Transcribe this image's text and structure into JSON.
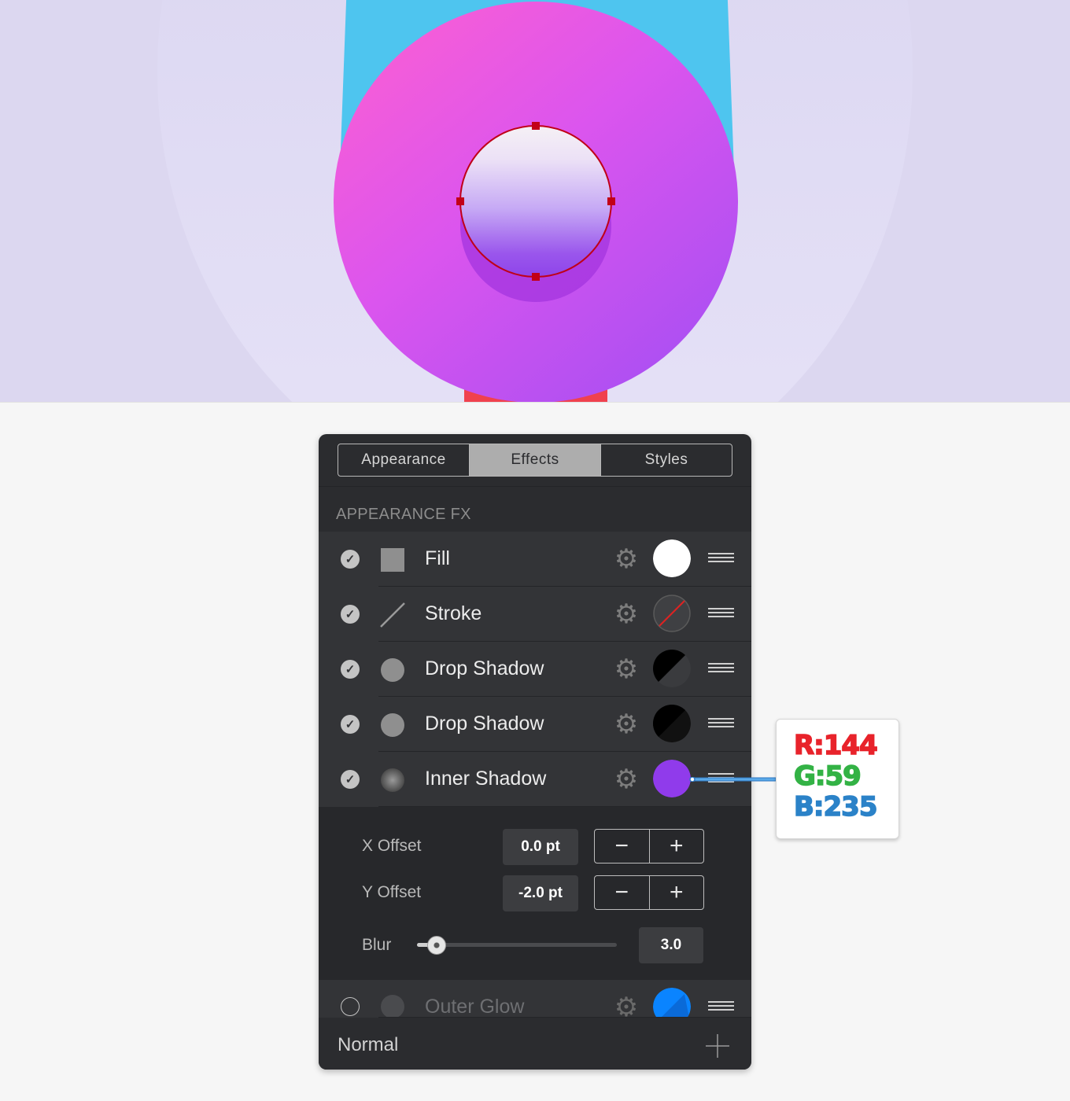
{
  "panel": {
    "tabs": [
      {
        "label": "Appearance",
        "active": false
      },
      {
        "label": "Effects",
        "active": true
      },
      {
        "label": "Styles",
        "active": false
      }
    ],
    "section_title": "APPEARANCE FX",
    "effects": [
      {
        "label": "Fill",
        "enabled": true,
        "icon": "square-fill-icon",
        "swatch": "#ffffff"
      },
      {
        "label": "Stroke",
        "enabled": true,
        "icon": "stroke-line-icon",
        "swatch": "none"
      },
      {
        "label": "Drop Shadow",
        "enabled": true,
        "icon": "circle-icon",
        "swatch": "#000000"
      },
      {
        "label": "Drop Shadow",
        "enabled": true,
        "icon": "circle-icon",
        "swatch": "#000000"
      },
      {
        "label": "Inner Shadow",
        "enabled": true,
        "icon": "soft-circle-icon",
        "swatch": "#903beb"
      },
      {
        "label": "Outer Glow",
        "enabled": false,
        "icon": "circle-icon",
        "swatch": "#0a84ff"
      }
    ],
    "settings": {
      "x_offset_label": "X Offset",
      "x_offset_value": "0.0 pt",
      "y_offset_label": "Y Offset",
      "y_offset_value": "-2.0 pt",
      "blur_label": "Blur",
      "blur_value": "3.0",
      "blur_fraction": 0.1,
      "minus_symbol": "−",
      "plus_symbol": "+"
    },
    "footer": {
      "blend_mode": "Normal"
    }
  },
  "color_callout": {
    "r": "R:144",
    "g": "G:59",
    "b": "B:235",
    "r_color": "#e8232b",
    "g_color": "#33b245",
    "b_color": "#2b82c8"
  },
  "colors": {
    "accent_purple": "#903beb",
    "selection_red": "#c20018",
    "panel_bg": "#2b2c2f"
  }
}
